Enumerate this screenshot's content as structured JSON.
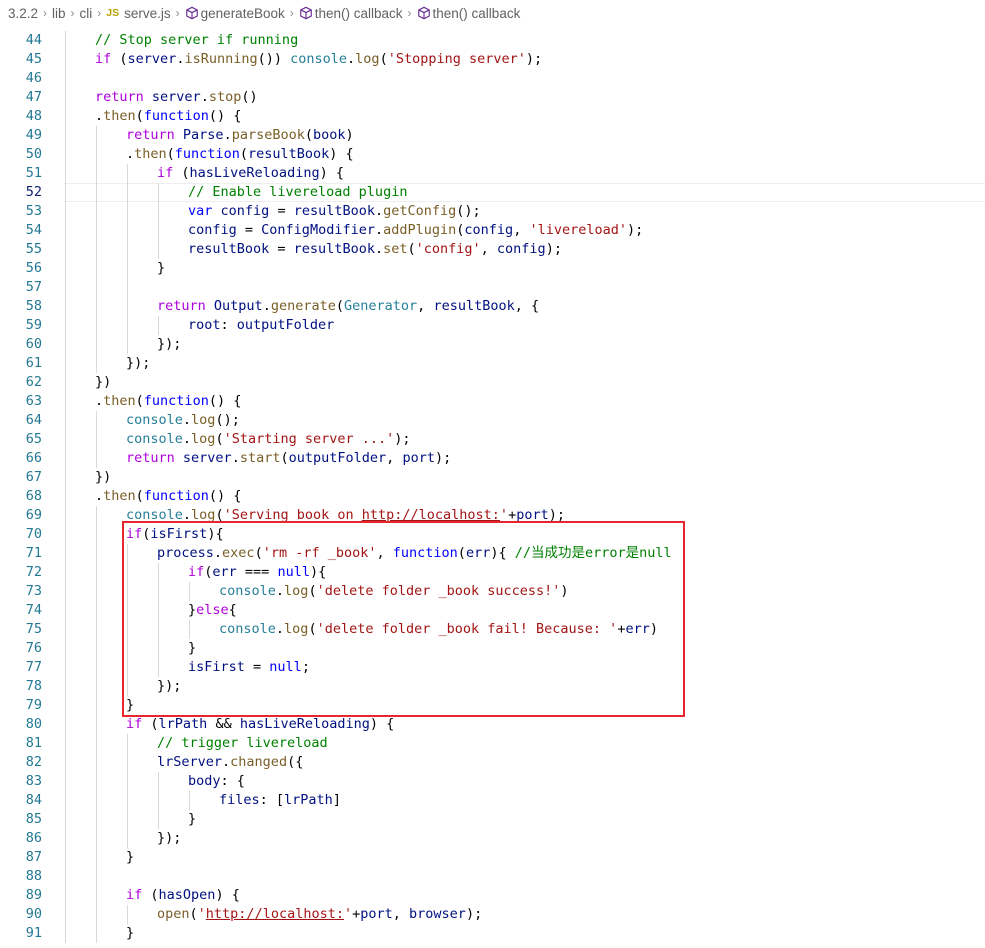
{
  "breadcrumb": [
    {
      "label": "3.2.2",
      "icon": ""
    },
    {
      "label": "lib",
      "icon": ""
    },
    {
      "label": "cli",
      "icon": ""
    },
    {
      "label": "serve.js",
      "icon": "js-file-icon"
    },
    {
      "label": "generateBook",
      "icon": "method-cube-icon"
    },
    {
      "label": "then() callback",
      "icon": "method-cube-icon"
    },
    {
      "label": "then() callback",
      "icon": "method-cube-icon"
    }
  ],
  "editor": {
    "active_line": 52,
    "highlight_box_color": "#e8262f",
    "lines": [
      {
        "n": 44,
        "indent": 1,
        "tokens": [
          [
            "com",
            "// Stop server if running"
          ]
        ]
      },
      {
        "n": 45,
        "indent": 1,
        "tokens": [
          [
            "ctl",
            "if"
          ],
          [
            "plain",
            " ("
          ],
          [
            "var",
            "server"
          ],
          [
            "plain",
            "."
          ],
          [
            "fn",
            "isRunning"
          ],
          [
            "plain",
            "()) "
          ],
          [
            "cls",
            "console"
          ],
          [
            "plain",
            "."
          ],
          [
            "fn",
            "log"
          ],
          [
            "plain",
            "("
          ],
          [
            "str",
            "'Stopping server'"
          ],
          [
            "plain",
            ");"
          ]
        ]
      },
      {
        "n": 46,
        "indent": 1,
        "tokens": []
      },
      {
        "n": 47,
        "indent": 1,
        "tokens": [
          [
            "ctl",
            "return"
          ],
          [
            "plain",
            " "
          ],
          [
            "var",
            "server"
          ],
          [
            "plain",
            "."
          ],
          [
            "fn",
            "stop"
          ],
          [
            "plain",
            "()"
          ]
        ]
      },
      {
        "n": 48,
        "indent": 1,
        "tokens": [
          [
            "plain",
            "."
          ],
          [
            "fn",
            "then"
          ],
          [
            "plain",
            "("
          ],
          [
            "kw",
            "function"
          ],
          [
            "plain",
            "() {"
          ]
        ]
      },
      {
        "n": 49,
        "indent": 2,
        "tokens": [
          [
            "ctl",
            "return"
          ],
          [
            "plain",
            " "
          ],
          [
            "var",
            "Parse"
          ],
          [
            "plain",
            "."
          ],
          [
            "fn",
            "parseBook"
          ],
          [
            "plain",
            "("
          ],
          [
            "var",
            "book"
          ],
          [
            "plain",
            ")"
          ]
        ]
      },
      {
        "n": 50,
        "indent": 2,
        "tokens": [
          [
            "plain",
            "."
          ],
          [
            "fn",
            "then"
          ],
          [
            "plain",
            "("
          ],
          [
            "kw",
            "function"
          ],
          [
            "plain",
            "("
          ],
          [
            "var",
            "resultBook"
          ],
          [
            "plain",
            ") {"
          ]
        ]
      },
      {
        "n": 51,
        "indent": 3,
        "tokens": [
          [
            "ctl",
            "if"
          ],
          [
            "plain",
            " ("
          ],
          [
            "var",
            "hasLiveReloading"
          ],
          [
            "plain",
            ") {"
          ]
        ]
      },
      {
        "n": 52,
        "indent": 4,
        "tokens": [
          [
            "com",
            "// Enable livereload plugin"
          ]
        ]
      },
      {
        "n": 53,
        "indent": 4,
        "tokens": [
          [
            "kw",
            "var"
          ],
          [
            "plain",
            " "
          ],
          [
            "var",
            "config"
          ],
          [
            "plain",
            " = "
          ],
          [
            "var",
            "resultBook"
          ],
          [
            "plain",
            "."
          ],
          [
            "fn",
            "getConfig"
          ],
          [
            "plain",
            "();"
          ]
        ]
      },
      {
        "n": 54,
        "indent": 4,
        "tokens": [
          [
            "var",
            "config"
          ],
          [
            "plain",
            " = "
          ],
          [
            "var",
            "ConfigModifier"
          ],
          [
            "plain",
            "."
          ],
          [
            "fn",
            "addPlugin"
          ],
          [
            "plain",
            "("
          ],
          [
            "var",
            "config"
          ],
          [
            "plain",
            ", "
          ],
          [
            "str",
            "'livereload'"
          ],
          [
            "plain",
            ");"
          ]
        ]
      },
      {
        "n": 55,
        "indent": 4,
        "tokens": [
          [
            "var",
            "resultBook"
          ],
          [
            "plain",
            " = "
          ],
          [
            "var",
            "resultBook"
          ],
          [
            "plain",
            "."
          ],
          [
            "fn",
            "set"
          ],
          [
            "plain",
            "("
          ],
          [
            "str",
            "'config'"
          ],
          [
            "plain",
            ", "
          ],
          [
            "var",
            "config"
          ],
          [
            "plain",
            ");"
          ]
        ]
      },
      {
        "n": 56,
        "indent": 3,
        "tokens": [
          [
            "plain",
            "}"
          ]
        ]
      },
      {
        "n": 57,
        "indent": 3,
        "tokens": []
      },
      {
        "n": 58,
        "indent": 3,
        "tokens": [
          [
            "ctl",
            "return"
          ],
          [
            "plain",
            " "
          ],
          [
            "var",
            "Output"
          ],
          [
            "plain",
            "."
          ],
          [
            "fn",
            "generate"
          ],
          [
            "plain",
            "("
          ],
          [
            "cls",
            "Generator"
          ],
          [
            "plain",
            ", "
          ],
          [
            "var",
            "resultBook"
          ],
          [
            "plain",
            ", {"
          ]
        ]
      },
      {
        "n": 59,
        "indent": 4,
        "tokens": [
          [
            "var",
            "root"
          ],
          [
            "plain",
            ": "
          ],
          [
            "var",
            "outputFolder"
          ]
        ]
      },
      {
        "n": 60,
        "indent": 3,
        "tokens": [
          [
            "plain",
            "});"
          ]
        ]
      },
      {
        "n": 61,
        "indent": 2,
        "tokens": [
          [
            "plain",
            "});"
          ]
        ]
      },
      {
        "n": 62,
        "indent": 1,
        "tokens": [
          [
            "plain",
            "})"
          ]
        ]
      },
      {
        "n": 63,
        "indent": 1,
        "tokens": [
          [
            "plain",
            "."
          ],
          [
            "fn",
            "then"
          ],
          [
            "plain",
            "("
          ],
          [
            "kw",
            "function"
          ],
          [
            "plain",
            "() {"
          ]
        ]
      },
      {
        "n": 64,
        "indent": 2,
        "tokens": [
          [
            "cls",
            "console"
          ],
          [
            "plain",
            "."
          ],
          [
            "fn",
            "log"
          ],
          [
            "plain",
            "();"
          ]
        ]
      },
      {
        "n": 65,
        "indent": 2,
        "tokens": [
          [
            "cls",
            "console"
          ],
          [
            "plain",
            "."
          ],
          [
            "fn",
            "log"
          ],
          [
            "plain",
            "("
          ],
          [
            "str",
            "'Starting server ...'"
          ],
          [
            "plain",
            ");"
          ]
        ]
      },
      {
        "n": 66,
        "indent": 2,
        "tokens": [
          [
            "ctl",
            "return"
          ],
          [
            "plain",
            " "
          ],
          [
            "var",
            "server"
          ],
          [
            "plain",
            "."
          ],
          [
            "fn",
            "start"
          ],
          [
            "plain",
            "("
          ],
          [
            "var",
            "outputFolder"
          ],
          [
            "plain",
            ", "
          ],
          [
            "var",
            "port"
          ],
          [
            "plain",
            ");"
          ]
        ]
      },
      {
        "n": 67,
        "indent": 1,
        "tokens": [
          [
            "plain",
            "})"
          ]
        ]
      },
      {
        "n": 68,
        "indent": 1,
        "tokens": [
          [
            "plain",
            "."
          ],
          [
            "fn",
            "then"
          ],
          [
            "plain",
            "("
          ],
          [
            "kw",
            "function"
          ],
          [
            "plain",
            "() {"
          ]
        ]
      },
      {
        "n": 69,
        "indent": 2,
        "tokens": [
          [
            "cls",
            "console"
          ],
          [
            "plain",
            "."
          ],
          [
            "fn",
            "log"
          ],
          [
            "plain",
            "("
          ],
          [
            "str",
            "'Serving book on "
          ],
          [
            "link",
            "http://localhost:"
          ],
          [
            "str",
            "'"
          ],
          [
            "plain",
            "+"
          ],
          [
            "var",
            "port"
          ],
          [
            "plain",
            ");"
          ]
        ]
      },
      {
        "n": 70,
        "indent": 2,
        "tokens": [
          [
            "ctl",
            "if"
          ],
          [
            "plain",
            "("
          ],
          [
            "var",
            "isFirst"
          ],
          [
            "plain",
            "){"
          ]
        ]
      },
      {
        "n": 71,
        "indent": 3,
        "tokens": [
          [
            "var",
            "process"
          ],
          [
            "plain",
            "."
          ],
          [
            "fn",
            "exec"
          ],
          [
            "plain",
            "("
          ],
          [
            "str",
            "'rm -rf _book'"
          ],
          [
            "plain",
            ", "
          ],
          [
            "kw",
            "function"
          ],
          [
            "plain",
            "("
          ],
          [
            "var",
            "err"
          ],
          [
            "plain",
            "){ "
          ],
          [
            "com",
            "//当成功是error是null"
          ]
        ]
      },
      {
        "n": 72,
        "indent": 4,
        "tokens": [
          [
            "ctl",
            "if"
          ],
          [
            "plain",
            "("
          ],
          [
            "var",
            "err"
          ],
          [
            "plain",
            " === "
          ],
          [
            "kw",
            "null"
          ],
          [
            "plain",
            "){"
          ]
        ]
      },
      {
        "n": 73,
        "indent": 5,
        "tokens": [
          [
            "cls",
            "console"
          ],
          [
            "plain",
            "."
          ],
          [
            "fn",
            "log"
          ],
          [
            "plain",
            "("
          ],
          [
            "str",
            "'delete folder _book success!'"
          ],
          [
            "plain",
            ")"
          ]
        ]
      },
      {
        "n": 74,
        "indent": 4,
        "tokens": [
          [
            "plain",
            "}"
          ],
          [
            "ctl",
            "else"
          ],
          [
            "plain",
            "{"
          ]
        ]
      },
      {
        "n": 75,
        "indent": 5,
        "tokens": [
          [
            "cls",
            "console"
          ],
          [
            "plain",
            "."
          ],
          [
            "fn",
            "log"
          ],
          [
            "plain",
            "("
          ],
          [
            "str",
            "'delete folder _book fail! Because: '"
          ],
          [
            "plain",
            "+"
          ],
          [
            "var",
            "err"
          ],
          [
            "plain",
            ")"
          ]
        ]
      },
      {
        "n": 76,
        "indent": 4,
        "tokens": [
          [
            "plain",
            "}"
          ]
        ]
      },
      {
        "n": 77,
        "indent": 4,
        "tokens": [
          [
            "var",
            "isFirst"
          ],
          [
            "plain",
            " = "
          ],
          [
            "kw",
            "null"
          ],
          [
            "plain",
            ";"
          ]
        ]
      },
      {
        "n": 78,
        "indent": 3,
        "tokens": [
          [
            "plain",
            "});"
          ]
        ]
      },
      {
        "n": 79,
        "indent": 2,
        "tokens": [
          [
            "plain",
            "}"
          ]
        ]
      },
      {
        "n": 80,
        "indent": 2,
        "tokens": [
          [
            "ctl",
            "if"
          ],
          [
            "plain",
            " ("
          ],
          [
            "var",
            "lrPath"
          ],
          [
            "plain",
            " && "
          ],
          [
            "var",
            "hasLiveReloading"
          ],
          [
            "plain",
            ") {"
          ]
        ]
      },
      {
        "n": 81,
        "indent": 3,
        "tokens": [
          [
            "com",
            "// trigger livereload"
          ]
        ]
      },
      {
        "n": 82,
        "indent": 3,
        "tokens": [
          [
            "var",
            "lrServer"
          ],
          [
            "plain",
            "."
          ],
          [
            "fn",
            "changed"
          ],
          [
            "plain",
            "({"
          ]
        ]
      },
      {
        "n": 83,
        "indent": 4,
        "tokens": [
          [
            "var",
            "body"
          ],
          [
            "plain",
            ": {"
          ]
        ]
      },
      {
        "n": 84,
        "indent": 5,
        "tokens": [
          [
            "var",
            "files"
          ],
          [
            "plain",
            ": ["
          ],
          [
            "var",
            "lrPath"
          ],
          [
            "plain",
            "]"
          ]
        ]
      },
      {
        "n": 85,
        "indent": 4,
        "tokens": [
          [
            "plain",
            "}"
          ]
        ]
      },
      {
        "n": 86,
        "indent": 3,
        "tokens": [
          [
            "plain",
            "});"
          ]
        ]
      },
      {
        "n": 87,
        "indent": 2,
        "tokens": [
          [
            "plain",
            "}"
          ]
        ]
      },
      {
        "n": 88,
        "indent": 2,
        "tokens": []
      },
      {
        "n": 89,
        "indent": 2,
        "tokens": [
          [
            "ctl",
            "if"
          ],
          [
            "plain",
            " ("
          ],
          [
            "var",
            "hasOpen"
          ],
          [
            "plain",
            ") {"
          ]
        ]
      },
      {
        "n": 90,
        "indent": 3,
        "tokens": [
          [
            "fn",
            "open"
          ],
          [
            "plain",
            "("
          ],
          [
            "str",
            "'"
          ],
          [
            "link",
            "http://localhost:"
          ],
          [
            "str",
            "'"
          ],
          [
            "plain",
            "+"
          ],
          [
            "var",
            "port"
          ],
          [
            "plain",
            ", "
          ],
          [
            "var",
            "browser"
          ],
          [
            "plain",
            ");"
          ]
        ]
      },
      {
        "n": 91,
        "indent": 2,
        "tokens": [
          [
            "plain",
            "}"
          ]
        ]
      }
    ]
  }
}
